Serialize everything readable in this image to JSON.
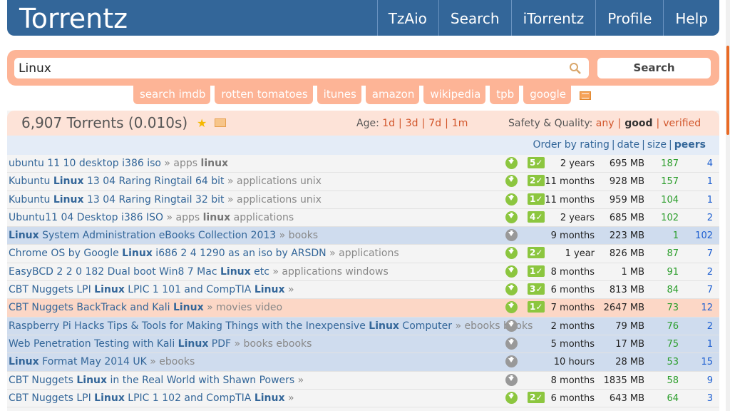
{
  "brand": "Torrentz",
  "nav": [
    "TzAio",
    "Search",
    "iTorrentz",
    "Profile",
    "Help"
  ],
  "search": {
    "value": "Linux",
    "button": "Search"
  },
  "external_links": [
    "search imdb",
    "rotten tomatoes",
    "itunes",
    "amazon",
    "wikipedia",
    "tpb",
    "google"
  ],
  "results_head": {
    "count": "6,907 Torrents (0.010s)",
    "age_label": "Age:",
    "age_options": [
      "1d",
      "3d",
      "7d",
      "1m"
    ],
    "safety_label": "Safety & Quality:",
    "safety_any": "any",
    "safety_good": "good",
    "safety_verified": "verified"
  },
  "order": {
    "label": "Order by",
    "rating": "rating",
    "date": "date",
    "size": "size",
    "peers": "peers"
  },
  "rows": [
    {
      "t1": "ubuntu 11 10 desktop i386 iso",
      "cat": " » apps ",
      "cb": "linux",
      "ce": "",
      "style": "",
      "dl": "green",
      "votes": "5",
      "age": "2 years",
      "size": "695 MB",
      "seeds": "187",
      "peers": "4"
    },
    {
      "t1": "Kubuntu ",
      "tb": "Linux",
      "t2": " 13 04 Raring Ringtail 64 bit",
      "cat": " » applications unix",
      "style": "",
      "dl": "green",
      "votes": "2",
      "age": "11 months",
      "size": "928 MB",
      "seeds": "157",
      "peers": "1"
    },
    {
      "t1": "Kubuntu ",
      "tb": "Linux",
      "t2": " 13 04 Raring Ringtail 32 bit",
      "cat": " » applications unix",
      "style": "",
      "dl": "green",
      "votes": "1",
      "age": "11 months",
      "size": "959 MB",
      "seeds": "104",
      "peers": "1"
    },
    {
      "t1": "Ubuntu11 04 Desktop i386 ISO",
      "cat": " » apps ",
      "cb": "linux",
      "ce": " applications",
      "style": "",
      "dl": "green",
      "votes": "4",
      "age": "2 years",
      "size": "685 MB",
      "seeds": "102",
      "peers": "2"
    },
    {
      "tb0": "Linux",
      "t1": " System Administration eBooks Collection 2013",
      "cat": " » books",
      "style": "blue",
      "dl": "grey",
      "votes": "",
      "age": "9 months",
      "size": "223 MB",
      "seeds": "1",
      "peers": "102"
    },
    {
      "t1": "Chrome OS by Google ",
      "tb": "Linux",
      "t2": " i686 2 4 1290 as an iso by ARSDN",
      "cat": " » applications",
      "style": "",
      "dl": "green",
      "votes": "2",
      "age": "1 year",
      "size": "826 MB",
      "seeds": "87",
      "peers": "7"
    },
    {
      "t1": "EasyBCD 2 2 0 182 Dual boot Win8 7 Mac ",
      "tb": "Linux",
      "t2": " etc",
      "cat": " » applications windows",
      "style": "",
      "dl": "green",
      "votes": "1",
      "age": "8 months",
      "size": "1 MB",
      "seeds": "91",
      "peers": "2"
    },
    {
      "t1": "CBT Nuggets LPI ",
      "tb": "Linux",
      "t2": " LPIC 1 101 and CompTIA ",
      "tb2": "Linux",
      "cat": " »",
      "style": "",
      "dl": "green",
      "votes": "3",
      "age": "6 months",
      "size": "813 MB",
      "seeds": "84",
      "peers": "7"
    },
    {
      "t1": "CBT Nuggets BackTrack and Kali ",
      "tb": "Linux",
      "cat": " » movies video",
      "style": "orange",
      "dl": "green",
      "votes": "1",
      "age": "7 months",
      "size": "2647 MB",
      "seeds": "73",
      "peers": "12"
    },
    {
      "t1": "Raspberry Pi Hacks Tips & Tools for Making Things with the Inexpensive ",
      "tb": "Linux",
      "t2": " Computer",
      "cat": " » ebooks books",
      "style": "blue",
      "dl": "grey",
      "votes": "",
      "age": "2 months",
      "size": "79 MB",
      "seeds": "76",
      "peers": "2"
    },
    {
      "t1": "Web Penetration Testing with Kali ",
      "tb": "Linux",
      "t2": " PDF",
      "cat": " » books ebooks",
      "style": "blue",
      "dl": "grey",
      "votes": "",
      "age": "5 months",
      "size": "17 MB",
      "seeds": "75",
      "peers": "1"
    },
    {
      "tb0": "Linux",
      "t1": " Format May 2014 UK",
      "cat": " » ebooks",
      "style": "blue",
      "dl": "grey",
      "votes": "",
      "age": "10 hours",
      "size": "28 MB",
      "seeds": "53",
      "peers": "15"
    },
    {
      "t1": "CBT Nuggets ",
      "tb": "Linux",
      "t2": " in the Real World with Shawn Powers",
      "cat": " »",
      "style": "",
      "dl": "grey",
      "votes": "",
      "age": "8 months",
      "size": "1835 MB",
      "seeds": "58",
      "peers": "9"
    },
    {
      "t1": "CBT Nuggets LPI ",
      "tb": "Linux",
      "t2": " LPIC 1 102 and CompTIA ",
      "tb2": "Linux",
      "cat": " »",
      "style": "",
      "dl": "green",
      "votes": "2",
      "age": "6 months",
      "size": "643 MB",
      "seeds": "64",
      "peers": "3"
    }
  ],
  "colors": {
    "header_blue": "#336699",
    "salmon": "#fdb496",
    "seed_green": "#2a9d2a",
    "peer_blue": "#1d5fd1",
    "link_orange": "#d2562b"
  }
}
